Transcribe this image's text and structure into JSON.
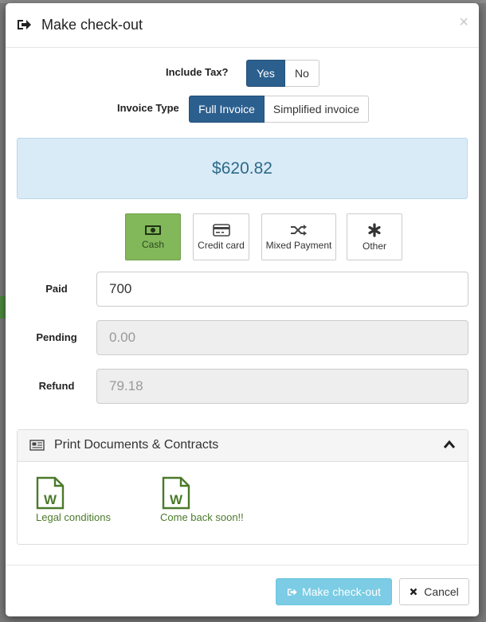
{
  "modal": {
    "title": "Make check-out",
    "close_glyph": "×"
  },
  "tax": {
    "label": "Include Tax?",
    "options": [
      "Yes",
      "No"
    ],
    "selected": "Yes"
  },
  "invoice": {
    "label": "Invoice Type",
    "options": [
      "Full Invoice",
      "Simplified invoice"
    ],
    "selected": "Full Invoice"
  },
  "total": "$620.82",
  "payment_methods": [
    {
      "label": "Cash",
      "icon": "cash-icon"
    },
    {
      "label": "Credit card",
      "icon": "credit-card-icon"
    },
    {
      "label": "Mixed Payment",
      "icon": "shuffle-icon"
    },
    {
      "label": "Other",
      "icon": "asterisk-icon"
    }
  ],
  "selected_payment": "Cash",
  "fields": {
    "paid": {
      "label": "Paid",
      "value": "700"
    },
    "pending": {
      "label": "Pending",
      "value": "0.00"
    },
    "refund": {
      "label": "Refund",
      "value": "79.18"
    }
  },
  "documents": {
    "title": "Print Documents & Contracts",
    "items": [
      {
        "label": "Legal conditions",
        "icon": "word-doc-icon"
      },
      {
        "label": "Come back soon!!",
        "icon": "word-doc-icon"
      }
    ]
  },
  "footer": {
    "checkout_label": "Make check-out",
    "cancel_label": "Cancel"
  },
  "colors": {
    "primary": "#2b5f8e",
    "total_bg": "#d9ebf7",
    "cash_active": "#82b85a",
    "info_button": "#5bc0de",
    "doc_green": "#4a7a2a"
  }
}
